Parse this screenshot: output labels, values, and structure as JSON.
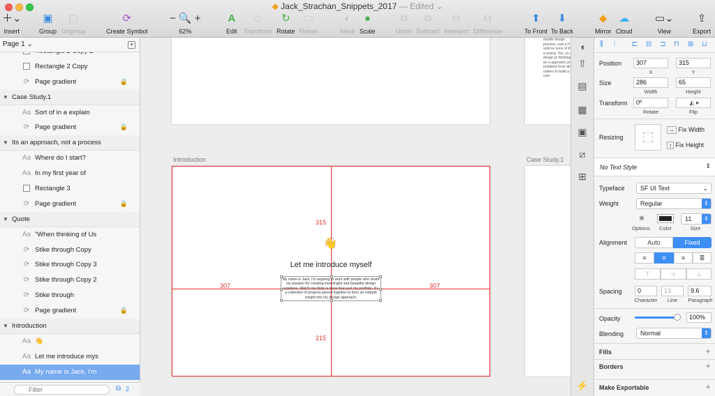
{
  "window": {
    "title": "Jack_Strachan_Snippets_2017",
    "edited": "— Edited"
  },
  "toolbar": {
    "insert": "Insert",
    "group": "Group",
    "ungroup": "Ungroup",
    "create_symbol": "Create Symbol",
    "zoom": "62%",
    "edit": "Edit",
    "transform": "Transform",
    "rotate": "Rotate",
    "flatten": "Flatten",
    "mask": "Mask",
    "scale": "Scale",
    "union": "Union",
    "subtract": "Subtract",
    "intersect": "Intersect",
    "difference": "Difference",
    "to_front": "To Front",
    "to_back": "To Back",
    "mirror": "Mirror",
    "cloud": "Cloud",
    "view": "View",
    "export": "Export"
  },
  "layers": {
    "page": "Page 1",
    "rows": [
      {
        "type": "rect",
        "label": "Rectangle 2 Copy 2"
      },
      {
        "type": "rect",
        "label": "Rectangle 2 Copy"
      },
      {
        "type": "symbol",
        "label": "Page gradient",
        "locked": true
      },
      {
        "type": "group",
        "label": "Case Study.1"
      },
      {
        "type": "text",
        "label": "Sort of in a explain"
      },
      {
        "type": "symbol",
        "label": "Page gradient",
        "locked": true
      },
      {
        "type": "group",
        "label": "Its an approach, not a process"
      },
      {
        "type": "text",
        "label": "Where do I start?"
      },
      {
        "type": "text",
        "label": "In my first year of"
      },
      {
        "type": "rect",
        "label": "Rectangle 3"
      },
      {
        "type": "symbol",
        "label": "Page gradient",
        "locked": true
      },
      {
        "type": "group",
        "label": "Quote"
      },
      {
        "type": "text",
        "label": "“When thinking of Us"
      },
      {
        "type": "symbol",
        "label": "Stike through Copy"
      },
      {
        "type": "symbol",
        "label": "Stike through Copy 3"
      },
      {
        "type": "symbol",
        "label": "Stike through Copy 2"
      },
      {
        "type": "symbol",
        "label": "Stike through"
      },
      {
        "type": "symbol",
        "label": "Page gradient",
        "locked": true
      },
      {
        "type": "group",
        "label": "Introduction"
      },
      {
        "type": "text",
        "label": "👋"
      },
      {
        "type": "text",
        "label": "Let me introduce mys"
      },
      {
        "type": "text",
        "label": "My name is Jack, I'm",
        "selected": true
      }
    ],
    "filter_placeholder": "Filter",
    "filter_count": "2"
  },
  "canvas": {
    "artboard_intro": "Introduction",
    "artboard_case": "Case Study.1",
    "emoji": "👋",
    "heading": "Let me introduce myself",
    "body": "My name is Jack, I'm aspiring to work with people who share my passion for creating meaningful and beautiful design solutions. Watch me think is more than just my portfolio. It's a collection of projects pieced together to form an indepth insight into my design approach.",
    "distance_top": "315",
    "distance_left": "307",
    "distance_right": "307",
    "distance_bottom": "215",
    "side_text": "double design process, vast a It's not until ne none of them a wrong. Yes, yo of a design pr thinking is an a approach you problems from able to unders to build a stron user."
  },
  "inspector": {
    "position_label": "Position",
    "x": "307",
    "y": "315",
    "x_label": "X",
    "y_label": "Y",
    "size_label": "Size",
    "width": "286",
    "height": "65",
    "width_label": "Width",
    "height_label": "Height",
    "transform_label": "Transform",
    "rotate": "0º",
    "rotate_label": "Rotate",
    "flip_label": "Flip",
    "resizing_label": "Resizing",
    "fix_width": "Fix Width",
    "fix_height": "Fix Height",
    "text_style": "No Text Style",
    "typeface_label": "Typeface",
    "typeface": "SF UI Text",
    "weight_label": "Weight",
    "weight": "Regular",
    "options_label": "Options",
    "color_label": "Color",
    "size_sub": "Size",
    "font_size": "11",
    "alignment_label": "Alignment",
    "auto": "Auto",
    "fixed": "Fixed",
    "spacing_label": "Spacing",
    "character": "0",
    "line": "13",
    "paragraph": "9.6",
    "character_label": "Character",
    "line_label": "Line",
    "paragraph_label": "Paragraph",
    "opacity_label": "Opacity",
    "opacity": "100%",
    "opacity_value": 1.0,
    "blending_label": "Blending",
    "blending": "Normal",
    "fills": "Fills",
    "borders": "Borders",
    "make_exportable": "Make Exportable"
  },
  "colors": {
    "accent": "#3e8ef5",
    "selection": "#78aaf0",
    "guide": "#e0312b"
  }
}
